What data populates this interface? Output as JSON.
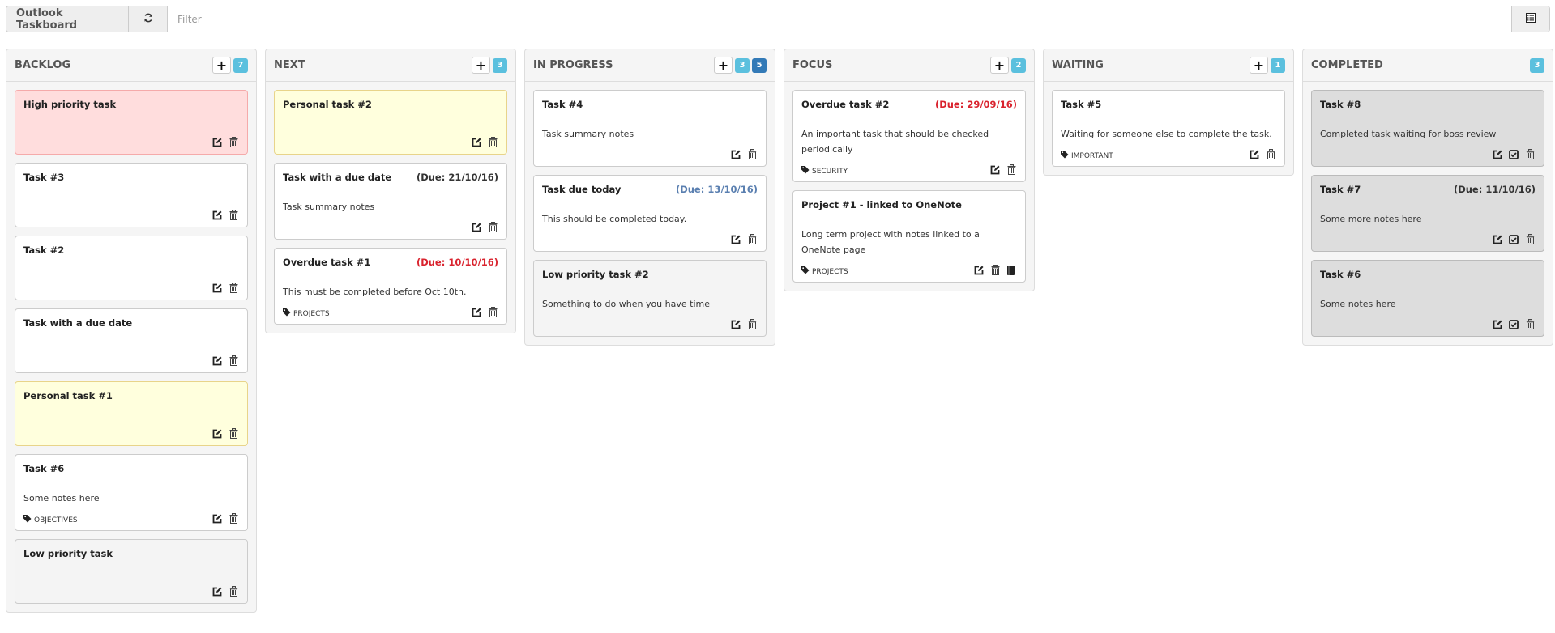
{
  "app": {
    "title": "Outlook Taskboard",
    "refresh_icon": "refresh-icon",
    "filter_placeholder": "Filter",
    "filter_value": "",
    "menu_icon": "list-icon"
  },
  "colors": {
    "high_priority_bg": "#ffdddd",
    "personal_bg": "#ffffdd",
    "low_priority_bg": "#f4f4f4",
    "completed_bg": "#dddddd",
    "overdue": "#d9232e",
    "due_today": "#5a7fb0",
    "badge_info": "#5bc0de",
    "badge_primary": "#337ab7"
  },
  "columns": [
    {
      "title": "BACKLOG",
      "add": true,
      "badges": [
        {
          "value": "7",
          "style": "info"
        }
      ],
      "cards": [
        {
          "title": "High priority task",
          "kind": "high",
          "due": "",
          "due_style": "",
          "notes": "",
          "category": "",
          "actions": [
            "edit",
            "delete"
          ]
        },
        {
          "title": "Task #3",
          "kind": "normal",
          "due": "",
          "due_style": "",
          "notes": "",
          "category": "",
          "actions": [
            "edit",
            "delete"
          ]
        },
        {
          "title": "Task #2",
          "kind": "normal",
          "due": "",
          "due_style": "",
          "notes": "",
          "category": "",
          "actions": [
            "edit",
            "delete"
          ]
        },
        {
          "title": "Task with a due date",
          "kind": "normal",
          "due": "",
          "due_style": "",
          "notes": "",
          "category": "",
          "actions": [
            "edit",
            "delete"
          ]
        },
        {
          "title": "Personal task #1",
          "kind": "personal",
          "due": "",
          "due_style": "",
          "notes": "",
          "category": "",
          "actions": [
            "edit",
            "delete"
          ]
        },
        {
          "title": "Task #6",
          "kind": "normal",
          "due": "",
          "due_style": "",
          "notes": "Some notes here",
          "category": "OBJECTIVES",
          "actions": [
            "edit",
            "delete"
          ]
        },
        {
          "title": "Low priority task",
          "kind": "low",
          "due": "",
          "due_style": "",
          "notes": "",
          "category": "",
          "actions": [
            "edit",
            "delete"
          ]
        }
      ]
    },
    {
      "title": "NEXT",
      "add": true,
      "badges": [
        {
          "value": "3",
          "style": "info"
        }
      ],
      "cards": [
        {
          "title": "Personal task #2",
          "kind": "personal",
          "due": "",
          "due_style": "",
          "notes": "",
          "category": "",
          "actions": [
            "edit",
            "delete"
          ]
        },
        {
          "title": "Task with a due date",
          "kind": "normal",
          "due": "(Due: 21/10/16)",
          "due_style": "",
          "notes": "Task summary notes",
          "category": "",
          "actions": [
            "edit",
            "delete"
          ]
        },
        {
          "title": "Overdue task #1",
          "kind": "normal",
          "due": "(Due: 10/10/16)",
          "due_style": "overdue",
          "notes": "This must be completed before Oct 10th.",
          "category": "PROJECTS",
          "actions": [
            "edit",
            "delete"
          ]
        }
      ]
    },
    {
      "title": "IN PROGRESS",
      "add": true,
      "badges": [
        {
          "value": "3",
          "style": "info"
        },
        {
          "value": "5",
          "style": "primary"
        }
      ],
      "cards": [
        {
          "title": "Task #4",
          "kind": "normal",
          "due": "",
          "due_style": "",
          "notes": "Task summary notes",
          "category": "",
          "actions": [
            "edit",
            "delete"
          ]
        },
        {
          "title": "Task due today",
          "kind": "normal",
          "due": "(Due: 13/10/16)",
          "due_style": "today",
          "notes": "This should be completed today.",
          "category": "",
          "actions": [
            "edit",
            "delete"
          ]
        },
        {
          "title": "Low priority task #2",
          "kind": "low",
          "due": "",
          "due_style": "",
          "notes": "Something to do when you have time",
          "category": "",
          "actions": [
            "edit",
            "delete"
          ]
        }
      ]
    },
    {
      "title": "FOCUS",
      "add": true,
      "badges": [
        {
          "value": "2",
          "style": "info"
        }
      ],
      "cards": [
        {
          "title": "Overdue task #2",
          "kind": "normal",
          "due": "(Due: 29/09/16)",
          "due_style": "overdue",
          "notes": "An important task that should be checked periodically",
          "category": "SECURITY",
          "actions": [
            "edit",
            "delete"
          ]
        },
        {
          "title": "Project #1 - linked to OneNote",
          "kind": "normal",
          "due": "",
          "due_style": "",
          "notes": "Long term project with notes linked to a OneNote page",
          "category": "PROJECTS",
          "actions": [
            "edit",
            "delete",
            "onenote"
          ]
        }
      ]
    },
    {
      "title": "WAITING",
      "add": true,
      "badges": [
        {
          "value": "1",
          "style": "info"
        }
      ],
      "cards": [
        {
          "title": "Task #5",
          "kind": "normal",
          "due": "",
          "due_style": "",
          "notes": "Waiting for someone else to complete the task.",
          "category": "IMPORTANT",
          "actions": [
            "edit",
            "delete"
          ]
        }
      ]
    },
    {
      "title": "COMPLETED",
      "add": false,
      "badges": [
        {
          "value": "3",
          "style": "info"
        }
      ],
      "cards": [
        {
          "title": "Task #8",
          "kind": "done",
          "due": "",
          "due_style": "",
          "notes": "Completed task waiting for boss review",
          "category": "",
          "actions": [
            "edit",
            "check",
            "delete"
          ]
        },
        {
          "title": "Task #7",
          "kind": "done",
          "due": "(Due: 11/10/16)",
          "due_style": "",
          "notes": "Some more notes here",
          "category": "",
          "actions": [
            "edit",
            "check",
            "delete"
          ]
        },
        {
          "title": "Task #6",
          "kind": "done",
          "due": "",
          "due_style": "",
          "notes": "Some notes here",
          "category": "",
          "actions": [
            "edit",
            "check",
            "delete"
          ]
        }
      ]
    }
  ]
}
